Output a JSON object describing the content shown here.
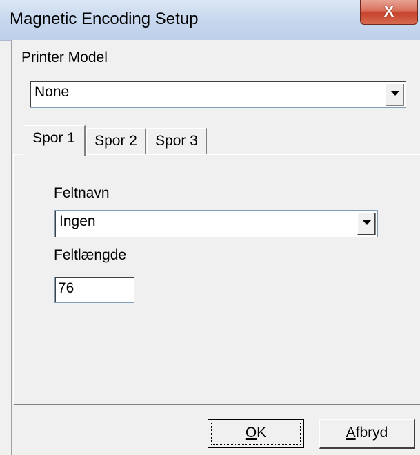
{
  "window": {
    "title": "Magnetic Encoding Setup",
    "close_glyph": "X"
  },
  "printer_model": {
    "label": "Printer Model",
    "selected": "None"
  },
  "tabs": [
    {
      "label": "Spor 1",
      "active": true
    },
    {
      "label": "Spor 2",
      "active": false
    },
    {
      "label": "Spor 3",
      "active": false
    }
  ],
  "track": {
    "field_name_label": "Feltnavn",
    "field_name_selected": "Ingen",
    "field_length_label": "Feltlængde",
    "field_length_value": "76"
  },
  "buttons": {
    "ok_mnemonic": "O",
    "ok_rest": "K",
    "cancel_mnemonic": "A",
    "cancel_rest": "fbryd"
  }
}
